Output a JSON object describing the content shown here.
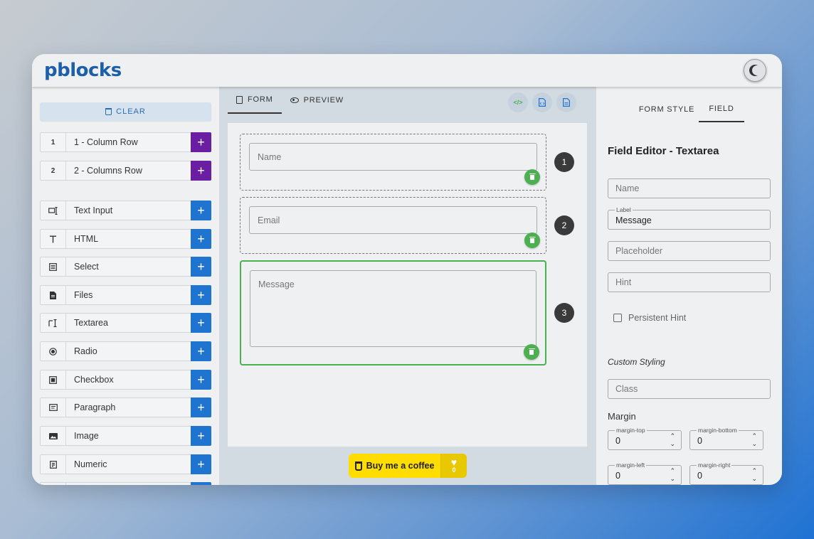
{
  "app": {
    "title": "pblocks"
  },
  "sidebar": {
    "clear_label": "CLEAR",
    "rows": [
      {
        "icon": "1",
        "label": "1 - Column Row"
      },
      {
        "icon": "2",
        "label": "2 - Columns Row"
      }
    ],
    "fields": [
      {
        "icon": "text-input-icon",
        "label": "Text Input"
      },
      {
        "icon": "html-icon",
        "label": "HTML"
      },
      {
        "icon": "select-icon",
        "label": "Select"
      },
      {
        "icon": "file-icon",
        "label": "Files"
      },
      {
        "icon": "textarea-icon",
        "label": "Textarea"
      },
      {
        "icon": "radio-icon",
        "label": "Radio"
      },
      {
        "icon": "checkbox-icon",
        "label": "Checkbox"
      },
      {
        "icon": "paragraph-icon",
        "label": "Paragraph"
      },
      {
        "icon": "image-icon",
        "label": "Image"
      },
      {
        "icon": "numeric-icon",
        "label": "Numeric"
      }
    ],
    "add_label": "+"
  },
  "middle": {
    "tabs": [
      {
        "label": "FORM",
        "active": true
      },
      {
        "label": "PREVIEW",
        "active": false
      }
    ],
    "form_fields": [
      {
        "placeholder": "Name",
        "number": "1"
      },
      {
        "placeholder": "Email",
        "number": "2"
      },
      {
        "placeholder": "Message",
        "number": "3"
      }
    ],
    "coffee": {
      "label": "Buy me a coffee",
      "count": "0"
    }
  },
  "right": {
    "tabs": [
      {
        "label": "FORM STYLE",
        "active": false
      },
      {
        "label": "FIELD",
        "active": true
      }
    ],
    "title": "Field Editor - Textarea",
    "name_placeholder": "Name",
    "label_caption": "Label",
    "label_value": "Message",
    "placeholder_placeholder": "Placeholder",
    "hint_placeholder": "Hint",
    "persistent_hint": "Persistent Hint",
    "custom_styling": "Custom Styling",
    "class_placeholder": "Class",
    "margin_title": "Margin",
    "margins": [
      {
        "caption": "margin-top",
        "value": "0"
      },
      {
        "caption": "margin-bottom",
        "value": "0"
      },
      {
        "caption": "margin-left",
        "value": "0"
      },
      {
        "caption": "margin-right",
        "value": "0"
      }
    ]
  },
  "colors": {
    "brand": "#1d5fa8",
    "row_add": "#6a1fa3",
    "field_add": "#1f74d0",
    "active_field": "#4caf50",
    "coffee": "#ffdd00"
  }
}
